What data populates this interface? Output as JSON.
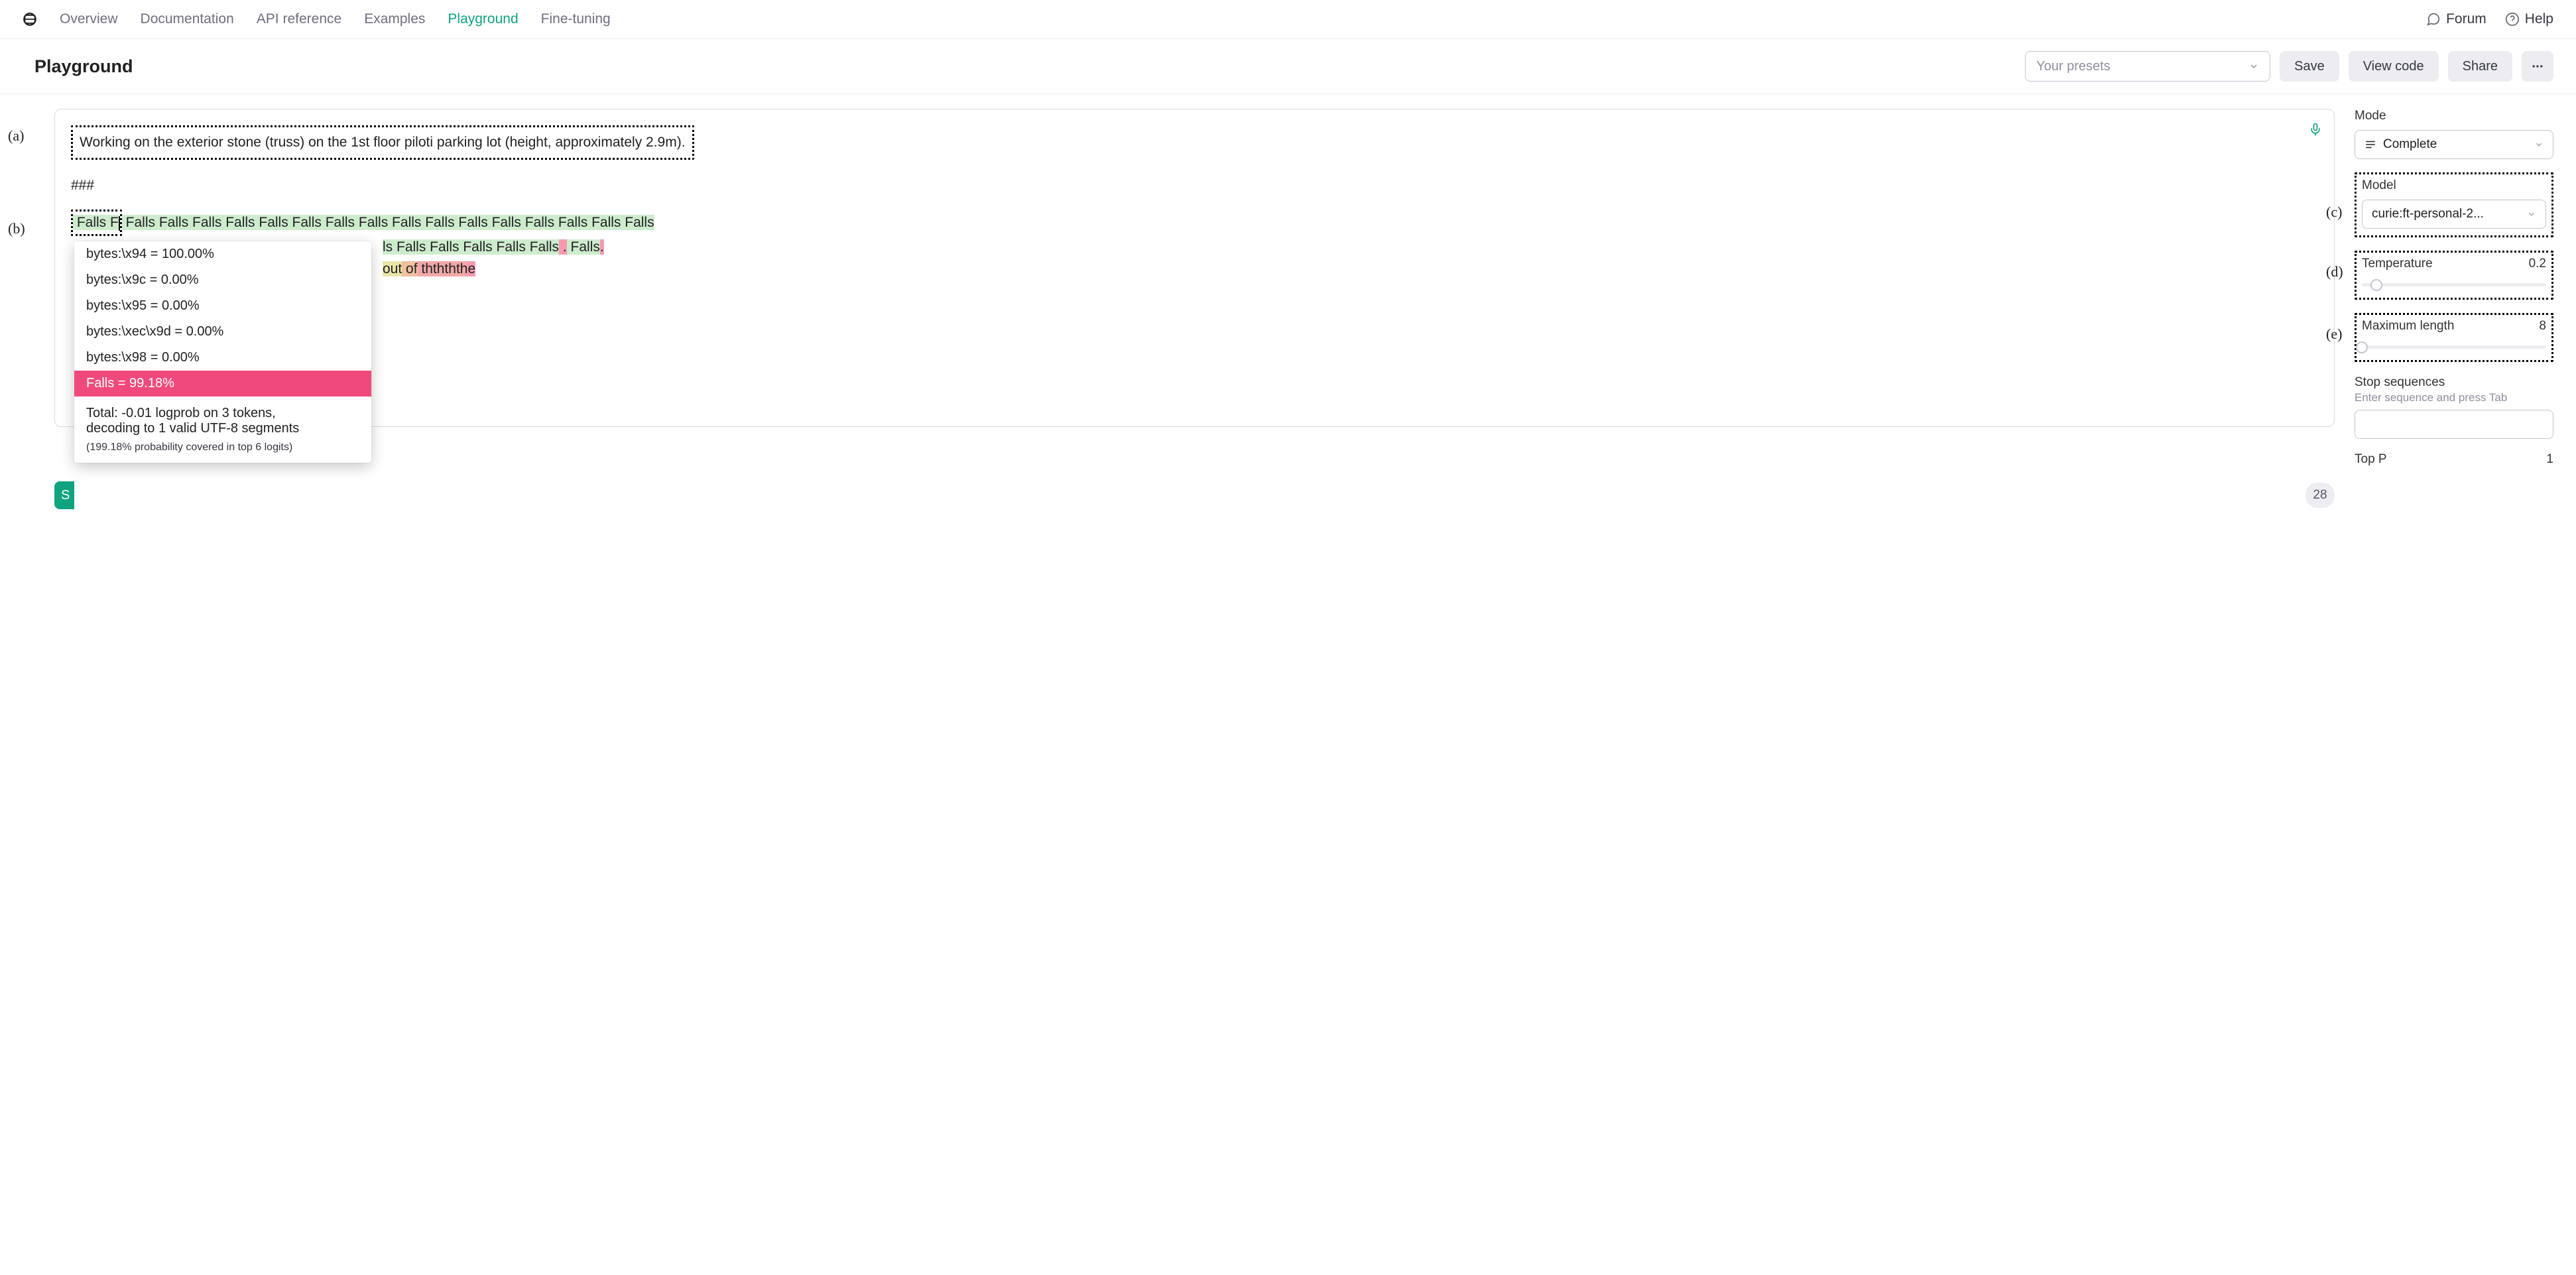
{
  "nav": {
    "items": [
      "Overview",
      "Documentation",
      "API reference",
      "Examples",
      "Playground",
      "Fine-tuning"
    ],
    "active_index": 4,
    "forum": "Forum",
    "help": "Help"
  },
  "header": {
    "title": "Playground",
    "preset_placeholder": "Your presets",
    "save": "Save",
    "view_code": "View code",
    "share": "Share"
  },
  "annotations": {
    "a": "(a)",
    "b": "(b)",
    "c": "(c)",
    "d": "(d)",
    "e": "(e)"
  },
  "editor": {
    "prompt": "Working on the exterior stone (truss) on the 1st floor piloti parking lot (height, approximately 2.9m).",
    "separator": "###",
    "output_line1": " Falls Falls Falls Falls Falls Falls Falls Falls Falls Falls Falls Falls Falls Falls Falls Falls",
    "output_line2_tail": "ls Falls Falls Falls Falls Falls",
    "output_line2_period1": " .",
    "output_line2_falls": " Falls",
    "output_line2_period2": ".",
    "output_line3_a": "out",
    "output_line3_b": " of",
    "output_line3_c": " thththth",
    "output_line3_d": "e",
    "token_count": "28"
  },
  "popover": {
    "rows": [
      "bytes:\\x94 = 100.00%",
      "bytes:\\x9c = 0.00%",
      "bytes:\\x95 = 0.00%",
      "bytes:\\xec\\x9d = 0.00%",
      "bytes:\\x98 = 0.00%"
    ],
    "highlight_row": " Falls = 99.18%",
    "summary_l1": "Total: -0.01 logprob on 3 tokens,",
    "summary_l2": "decoding to 1 valid UTF-8 segments",
    "footnote": "(199.18% probability covered in top 6 logits)"
  },
  "panel": {
    "mode_label": "Mode",
    "mode_value": "Complete",
    "model_label": "Model",
    "model_value": "curie:ft-personal-2...",
    "temperature_label": "Temperature",
    "temperature_value": "0.2",
    "temperature_pos_pct": 8,
    "maxlen_label": "Maximum length",
    "maxlen_value": "8",
    "maxlen_pos_pct": 0,
    "stop_label": "Stop sequences",
    "stop_hint": "Enter sequence and press Tab",
    "topp_label": "Top P",
    "topp_value": "1"
  }
}
